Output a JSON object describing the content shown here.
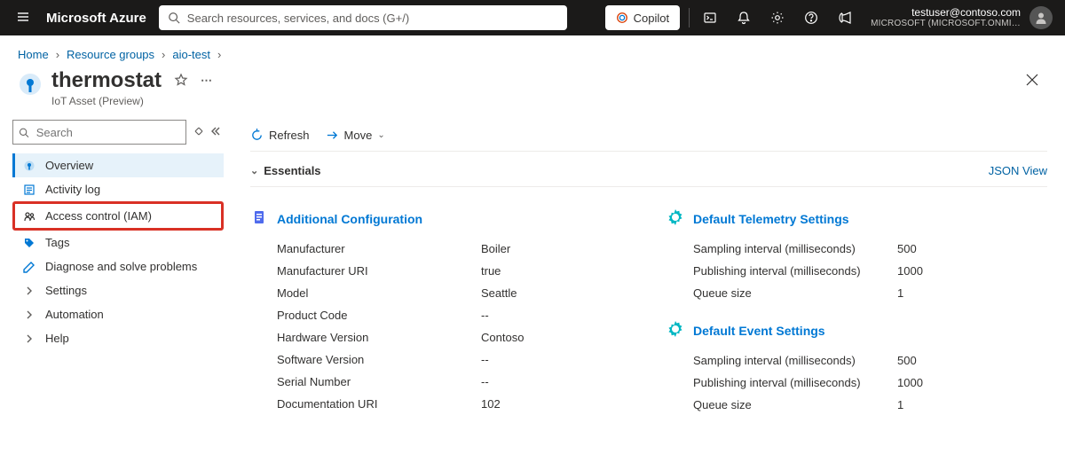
{
  "topbar": {
    "brand": "Microsoft Azure",
    "search_placeholder": "Search resources, services, and docs (G+/)",
    "copilot_label": "Copilot",
    "user_email": "testuser@contoso.com",
    "user_tenant": "MICROSOFT (MICROSOFT.ONMI…"
  },
  "breadcrumbs": {
    "home": "Home",
    "group": "Resource groups",
    "rg_name": "aio-test"
  },
  "header": {
    "title": "thermostat",
    "subtitle": "IoT Asset (Preview)"
  },
  "sidebar": {
    "search_placeholder": "Search",
    "items": [
      {
        "label": "Overview"
      },
      {
        "label": "Activity log"
      },
      {
        "label": "Access control (IAM)"
      },
      {
        "label": "Tags"
      },
      {
        "label": "Diagnose and solve problems"
      },
      {
        "label": "Settings"
      },
      {
        "label": "Automation"
      },
      {
        "label": "Help"
      }
    ]
  },
  "toolbar": {
    "refresh_label": "Refresh",
    "move_label": "Move"
  },
  "essentials": {
    "label": "Essentials",
    "json_view_label": "JSON View"
  },
  "sections": {
    "additional": {
      "title": "Additional Configuration",
      "rows": [
        {
          "label": "Manufacturer",
          "value": "Boiler"
        },
        {
          "label": "Manufacturer URI",
          "value": "true"
        },
        {
          "label": "Model",
          "value": "Seattle"
        },
        {
          "label": "Product Code",
          "value": "--"
        },
        {
          "label": "Hardware Version",
          "value": "Contoso"
        },
        {
          "label": "Software Version",
          "value": "--"
        },
        {
          "label": "Serial Number",
          "value": "--"
        },
        {
          "label": "Documentation URI",
          "value": "102"
        }
      ]
    },
    "telemetry": {
      "title": "Default Telemetry Settings",
      "rows": [
        {
          "label": "Sampling interval (milliseconds)",
          "value": "500"
        },
        {
          "label": "Publishing interval (milliseconds)",
          "value": "1000"
        },
        {
          "label": "Queue size",
          "value": "1"
        }
      ]
    },
    "event": {
      "title": "Default Event Settings",
      "rows": [
        {
          "label": "Sampling interval (milliseconds)",
          "value": "500"
        },
        {
          "label": "Publishing interval (milliseconds)",
          "value": "1000"
        },
        {
          "label": "Queue size",
          "value": "1"
        }
      ]
    }
  }
}
